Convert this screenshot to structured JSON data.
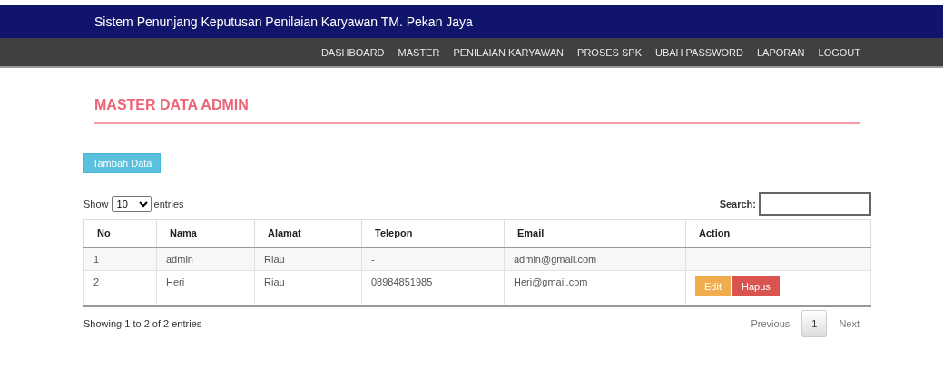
{
  "header": {
    "title": "Sistem Penunjang Keputusan Penilaian Karyawan TM. Pekan Jaya"
  },
  "nav": [
    "DASHBOARD",
    "MASTER",
    "PENILAIAN KARYAWAN",
    "PROSES SPK",
    "UBAH PASSWORD",
    "LAPORAN",
    "LOGOUT"
  ],
  "page_title": "MASTER DATA ADMIN",
  "add_button": "Tambah Data",
  "length": {
    "before": "Show",
    "value": "10",
    "after": "entries"
  },
  "search": {
    "label": "Search:"
  },
  "table": {
    "columns": [
      "No",
      "Nama",
      "Alamat",
      "Telepon",
      "Email",
      "Action"
    ],
    "rows": [
      {
        "cells": [
          "1",
          "admin",
          "Riau",
          "-",
          "admin@gmail.com"
        ],
        "actions": []
      },
      {
        "cells": [
          "2",
          "Heri",
          "Riau",
          "08984851985",
          "Heri@gmail.com"
        ],
        "actions": [
          {
            "label": "Edit",
            "kind": "edit"
          },
          {
            "label": "Hapus",
            "kind": "delete"
          }
        ]
      }
    ]
  },
  "info": "Showing 1 to 2 of 2 entries",
  "pagination": [
    {
      "label": "Previous",
      "kind": "prev",
      "selected": false
    },
    {
      "label": "1",
      "kind": "page",
      "selected": true
    },
    {
      "label": "Next",
      "kind": "next",
      "selected": false
    }
  ]
}
